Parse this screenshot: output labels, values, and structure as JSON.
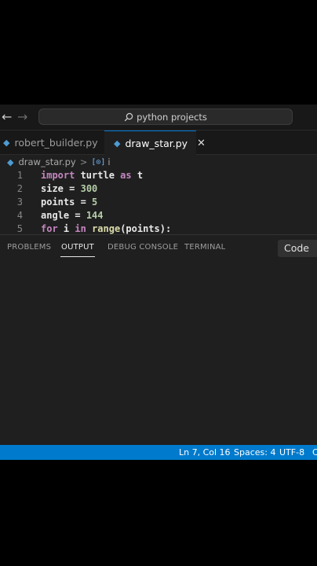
{
  "titlebar": {
    "back": "←",
    "forward": "→",
    "command_center": "python projects"
  },
  "tabs": [
    {
      "label": "robert_builder.py",
      "active": false
    },
    {
      "label": "draw_star.py",
      "active": true,
      "close": "✕"
    }
  ],
  "breadcrumb": {
    "file": "draw_star.py",
    "separator": ">",
    "symbol": "i"
  },
  "code_lines": [
    {
      "number": "1",
      "tokens": [
        {
          "t": "import",
          "c": "kw"
        },
        {
          "t": " turtle ",
          "c": "id"
        },
        {
          "t": "as",
          "c": "kw"
        },
        {
          "t": " t",
          "c": "id"
        }
      ]
    },
    {
      "number": "2",
      "tokens": [
        {
          "t": "size",
          "c": "id"
        },
        {
          "t": " = ",
          "c": "id"
        },
        {
          "t": "300",
          "c": "num"
        }
      ]
    },
    {
      "number": "3",
      "tokens": [
        {
          "t": "points",
          "c": "id"
        },
        {
          "t": " = ",
          "c": "id"
        },
        {
          "t": "5",
          "c": "num"
        }
      ]
    },
    {
      "number": "4",
      "tokens": [
        {
          "t": "angle",
          "c": "id"
        },
        {
          "t": " = ",
          "c": "id"
        },
        {
          "t": "144",
          "c": "num"
        }
      ]
    },
    {
      "number": "5",
      "tokens": [
        {
          "t": "for",
          "c": "kw"
        },
        {
          "t": " i ",
          "c": "id"
        },
        {
          "t": "in",
          "c": "kw"
        },
        {
          "t": " ",
          "c": "id"
        },
        {
          "t": "range",
          "c": "fn"
        },
        {
          "t": "(points):",
          "c": "id"
        }
      ]
    }
  ],
  "panel": {
    "tabs": [
      "PROBLEMS",
      "OUTPUT",
      "DEBUG CONSOLE",
      "TERMINAL"
    ],
    "active_tab": "OUTPUT",
    "dropdown": "Code"
  },
  "statusbar": {
    "position": "Ln 7, Col 16",
    "spaces": "Spaces: 4",
    "encoding": "UTF-8",
    "eol": "C"
  },
  "colors": {
    "accent": "#007acc",
    "editor_bg": "#1f1f1f",
    "keyword": "#c586c0",
    "number": "#b5cea8"
  }
}
